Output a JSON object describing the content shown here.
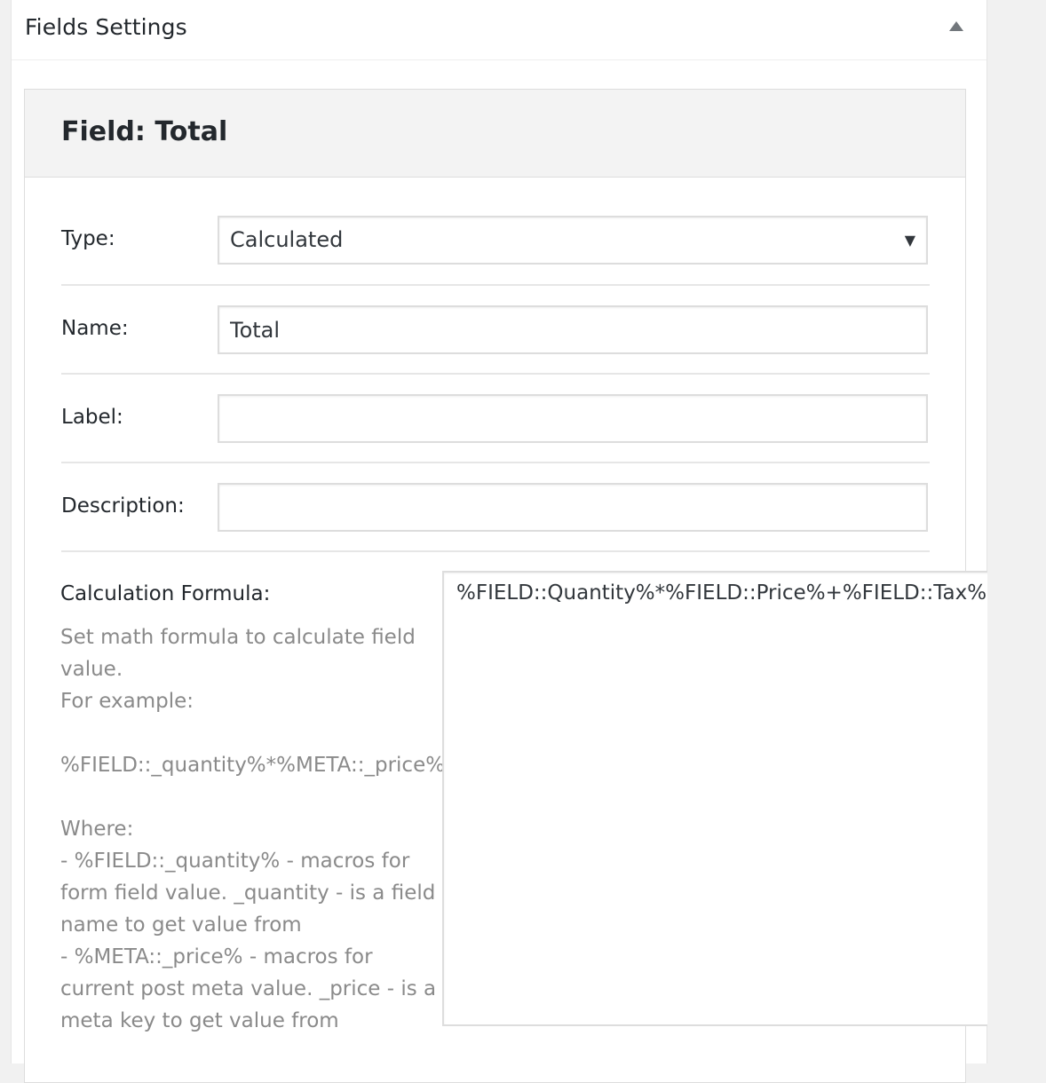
{
  "metabox": {
    "title": "Fields Settings"
  },
  "field": {
    "title": "Field: Total",
    "type": {
      "label": "Type:",
      "value": "Calculated",
      "arrow": "▼"
    },
    "name": {
      "label": "Name:",
      "value": "Total"
    },
    "label_row": {
      "label": "Label:",
      "value": ""
    },
    "description": {
      "label": "Description:",
      "value": ""
    },
    "formula": {
      "label": "Calculation Formula:",
      "help_line1": "Set math formula to calculate field value.",
      "help_line2": "For example:",
      "help_example": "%FIELD::_quantity%*%META::_price%",
      "help_where": "Where:",
      "help_field_macro": "- %FIELD::_quantity% - macros for form field value. _quantity - is a field name to get value from",
      "help_meta_macro": "- %META::_price% - macros for current post meta value. _price - is a meta key to get value from",
      "value": "%FIELD::Quantity%*%FIELD::Price%+%FIELD::Tax%"
    }
  },
  "icons": {
    "toggle": "collapse-arrow-up-icon"
  }
}
